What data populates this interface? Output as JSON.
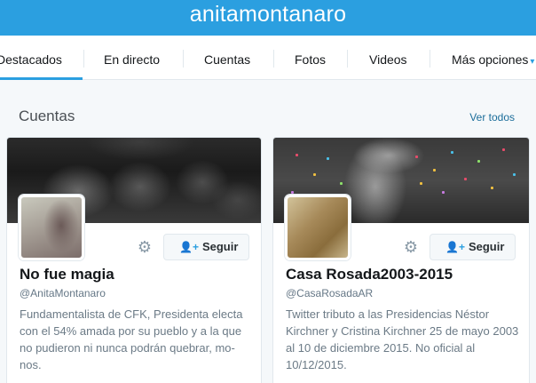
{
  "header": {
    "title": "anitamontanaro"
  },
  "tabs": [
    {
      "label": "Destacados"
    },
    {
      "label": "En directo"
    },
    {
      "label": "Cuentas"
    },
    {
      "label": "Fotos"
    },
    {
      "label": "Videos"
    },
    {
      "label": "Más opciones"
    }
  ],
  "section": {
    "title": "Cuentas",
    "see_all": "Ver todos"
  },
  "cards": [
    {
      "name": "No fue magia",
      "handle": "@AnitaMontanaro",
      "bio": "Fundamentalista de CFK, Presidenta electa con el 54% amada por su pueblo y a la que no pudieron ni nunca podrán quebrar, mo-nos.",
      "follow_label": "Seguir"
    },
    {
      "name": "Casa Rosada2003-2015",
      "handle": "@CasaRosadaAR",
      "bio": "Twitter tributo a las Presidencias Néstor Kirchner y Cristina Kirchner 25 de mayo 2003 al 10 de diciembre 2015. No oficial al 10/12/2015.",
      "follow_label": "Seguir"
    }
  ],
  "colors": {
    "brand": "#2b9fe0",
    "link": "#1b6d9a"
  }
}
